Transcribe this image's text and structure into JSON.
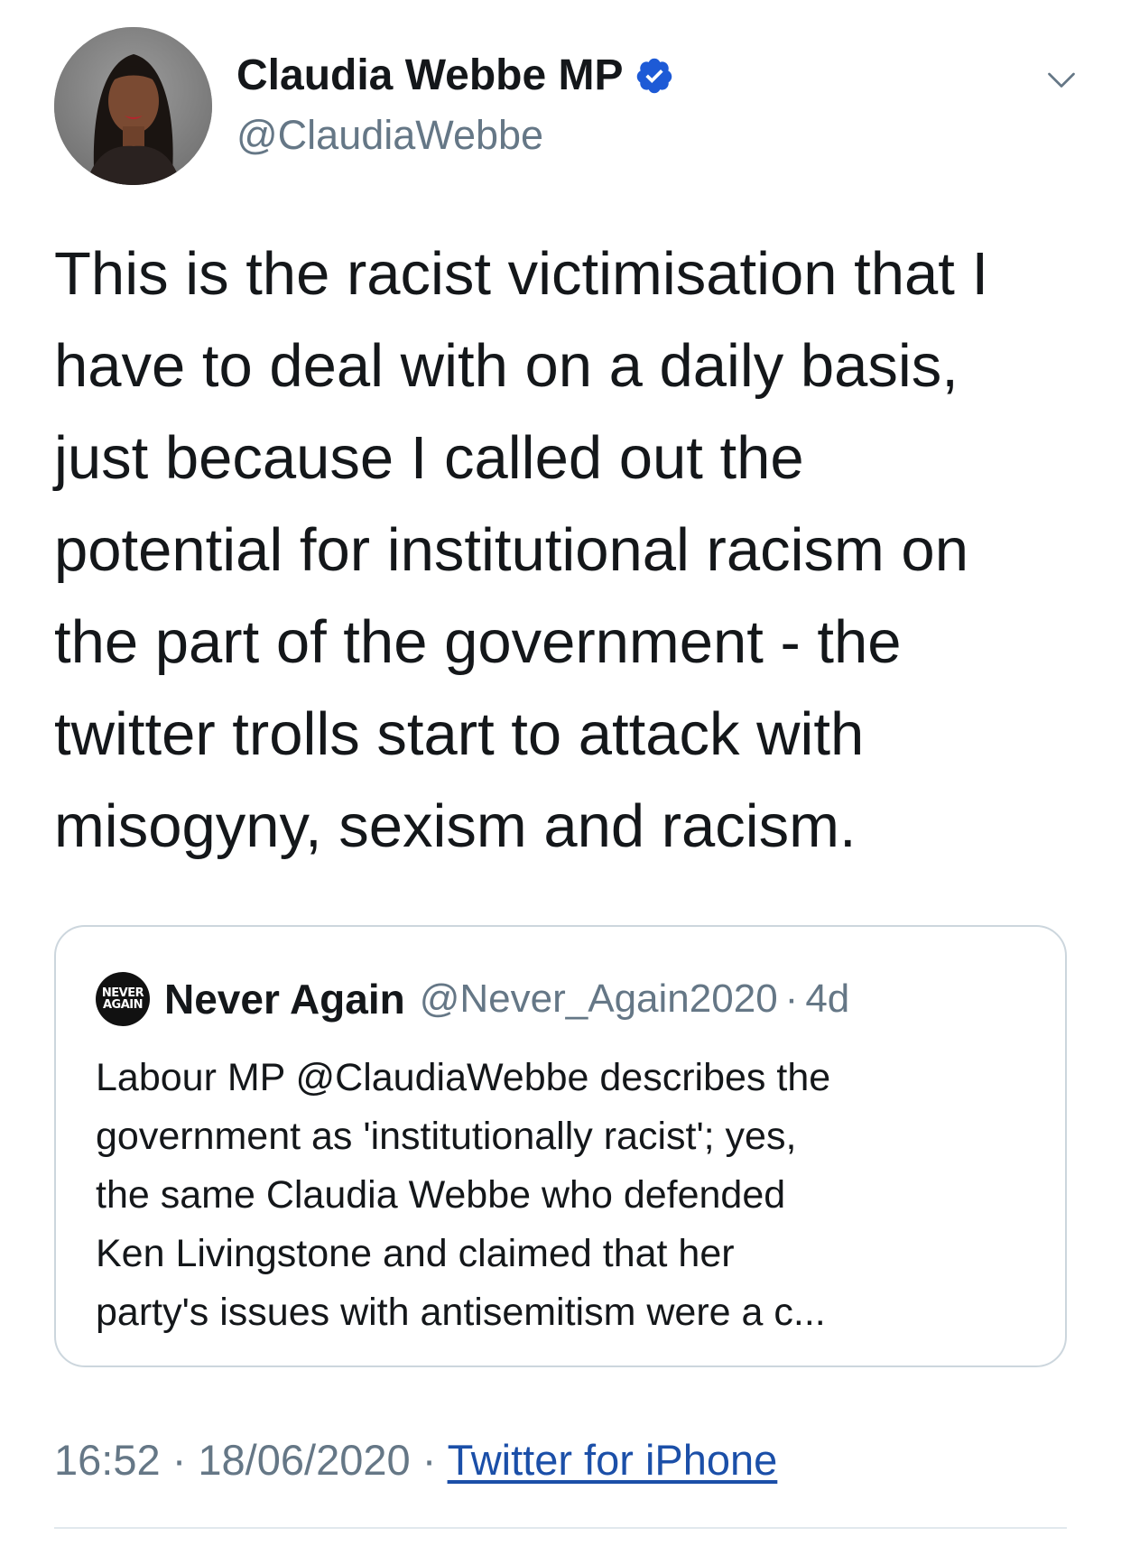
{
  "author": {
    "display_name": "Claudia Webbe MP",
    "handle": "@ClaudiaWebbe",
    "verified": true
  },
  "tweet": {
    "lines": [
      "This is the racist victimisation that I",
      "have to deal with on a daily basis,",
      "just because I called out the",
      "potential for institutional racism on",
      "the part of the government - the",
      "twitter trolls start to attack with",
      "misogyny, sexism and racism."
    ]
  },
  "quoted_tweet": {
    "avatar_text_top": "NEVER",
    "avatar_text_bottom": "AGAIN",
    "display_name": "Never Again",
    "handle": "@Never_Again2020",
    "separator": "·",
    "time": "4d",
    "lines": [
      "Labour MP @ClaudiaWebbe describes the",
      "government as 'institutionally racist'; yes,",
      "the same Claudia Webbe who defended",
      "Ken Livingstone and claimed that her",
      "party's issues with antisemitism were a c..."
    ]
  },
  "meta": {
    "time": "16:52",
    "separator": "·",
    "date": "18/06/2020",
    "source": "Twitter for iPhone"
  },
  "icons": {
    "verified": "verified-badge-icon",
    "menu": "chevron-down-icon"
  },
  "colors": {
    "text": "#14171a",
    "secondary": "#657786",
    "verified": "#1d5ad6",
    "link": "#1b4fa8",
    "border": "#ccd6dd"
  }
}
